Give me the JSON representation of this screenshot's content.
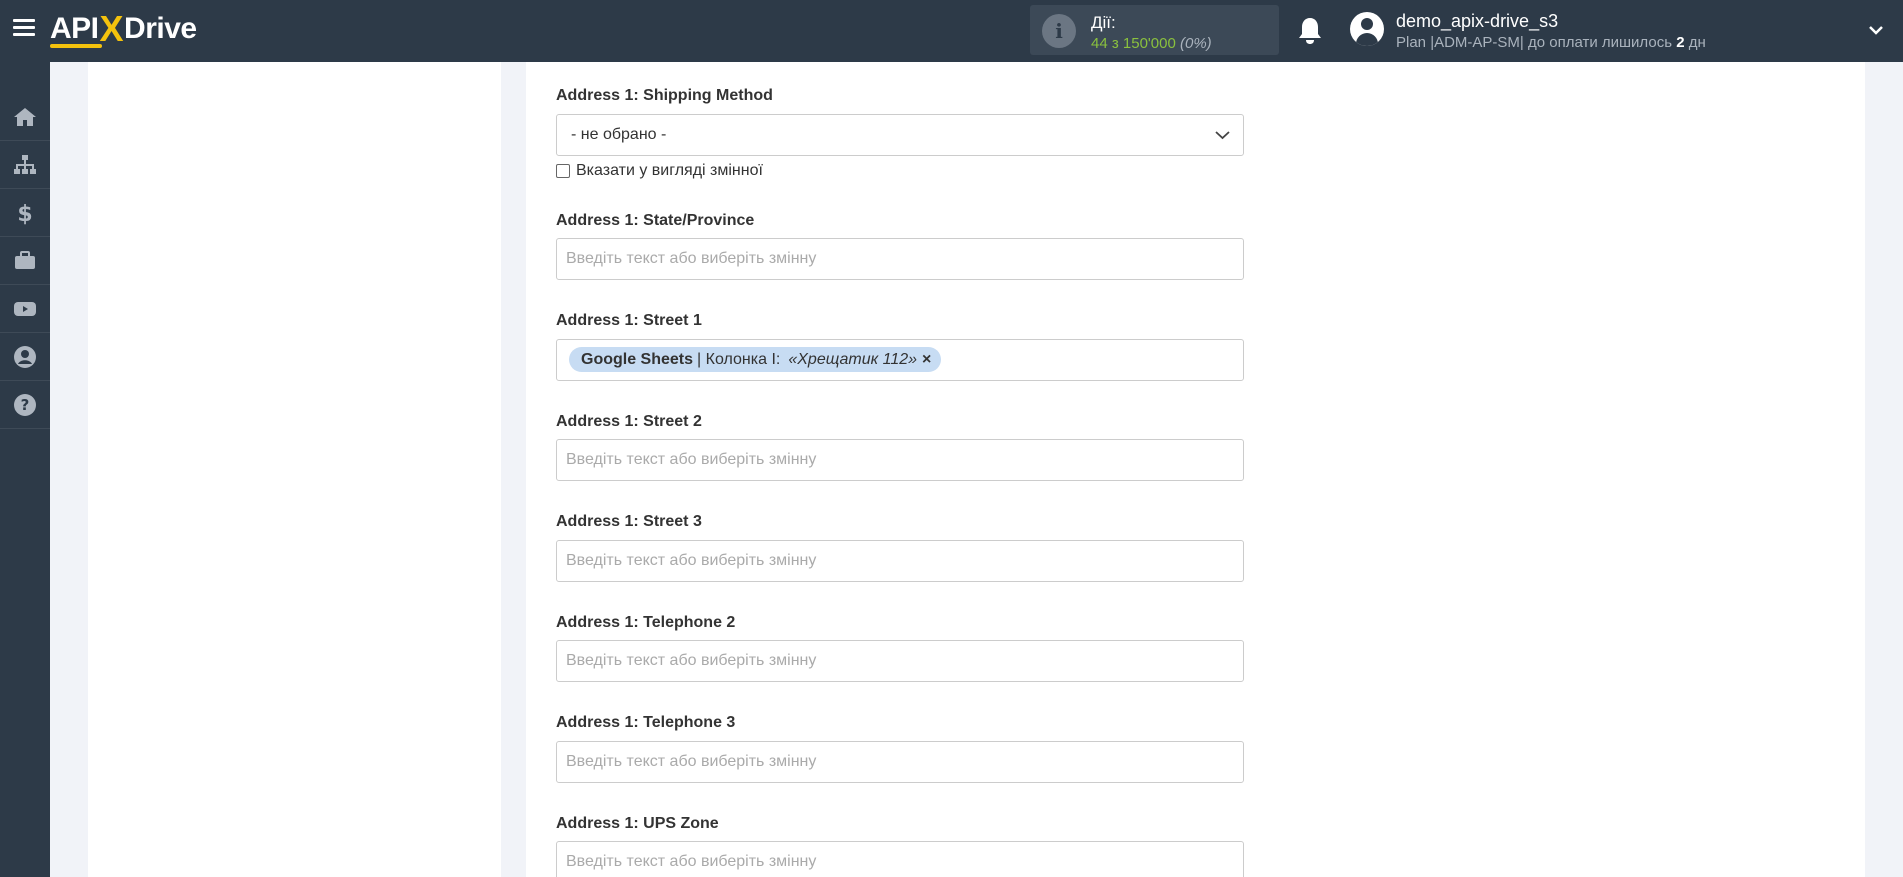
{
  "header": {
    "logo_left": "API",
    "logo_x": "X",
    "logo_right": "Drive",
    "actions_label": "Дії:",
    "actions_count": "44 з 150'000",
    "actions_percent": "(0%)",
    "username": "demo_apix-drive_s3",
    "plan_text": "Plan |ADM-AP-SM| до оплати лишилось ",
    "plan_days": "2",
    "plan_days_unit": " дн"
  },
  "sidebar": {
    "items": [
      {
        "icon": "home-icon"
      },
      {
        "icon": "sitemap-icon"
      },
      {
        "icon": "dollar-icon"
      },
      {
        "icon": "briefcase-icon"
      },
      {
        "icon": "youtube-icon"
      },
      {
        "icon": "user-circle-icon"
      },
      {
        "icon": "help-icon"
      }
    ]
  },
  "form": {
    "shipping_method": {
      "label": "Address 1: Shipping Method",
      "selected": "- не обрано -",
      "checkbox_label": "Вказати у вигляді змінної"
    },
    "state_province": {
      "label": "Address 1: State/Province",
      "placeholder": "Введіть текст або виберіть змінну"
    },
    "street1": {
      "label": "Address 1: Street 1",
      "tag_source": "Google Sheets",
      "tag_column": "| Колонка I:",
      "tag_value": "«Хрещатик 112»",
      "tag_remove": "×"
    },
    "street2": {
      "label": "Address 1: Street 2",
      "placeholder": "Введіть текст або виберіть змінну"
    },
    "street3": {
      "label": "Address 1: Street 3",
      "placeholder": "Введіть текст або виберіть змінну"
    },
    "telephone2": {
      "label": "Address 1: Telephone 2",
      "placeholder": "Введіть текст або виберіть змінну"
    },
    "telephone3": {
      "label": "Address 1: Telephone 3",
      "placeholder": "Введіть текст або виберіть змінну"
    },
    "ups_zone": {
      "label": "Address 1: UPS Zone",
      "placeholder": "Введіть текст або виберіть змінну"
    }
  },
  "colors": {
    "header_bg": "#2d3a48",
    "accent_yellow": "#f4c20d",
    "actions_green": "#8ac13e",
    "tag_bg": "#c7dcf3"
  }
}
